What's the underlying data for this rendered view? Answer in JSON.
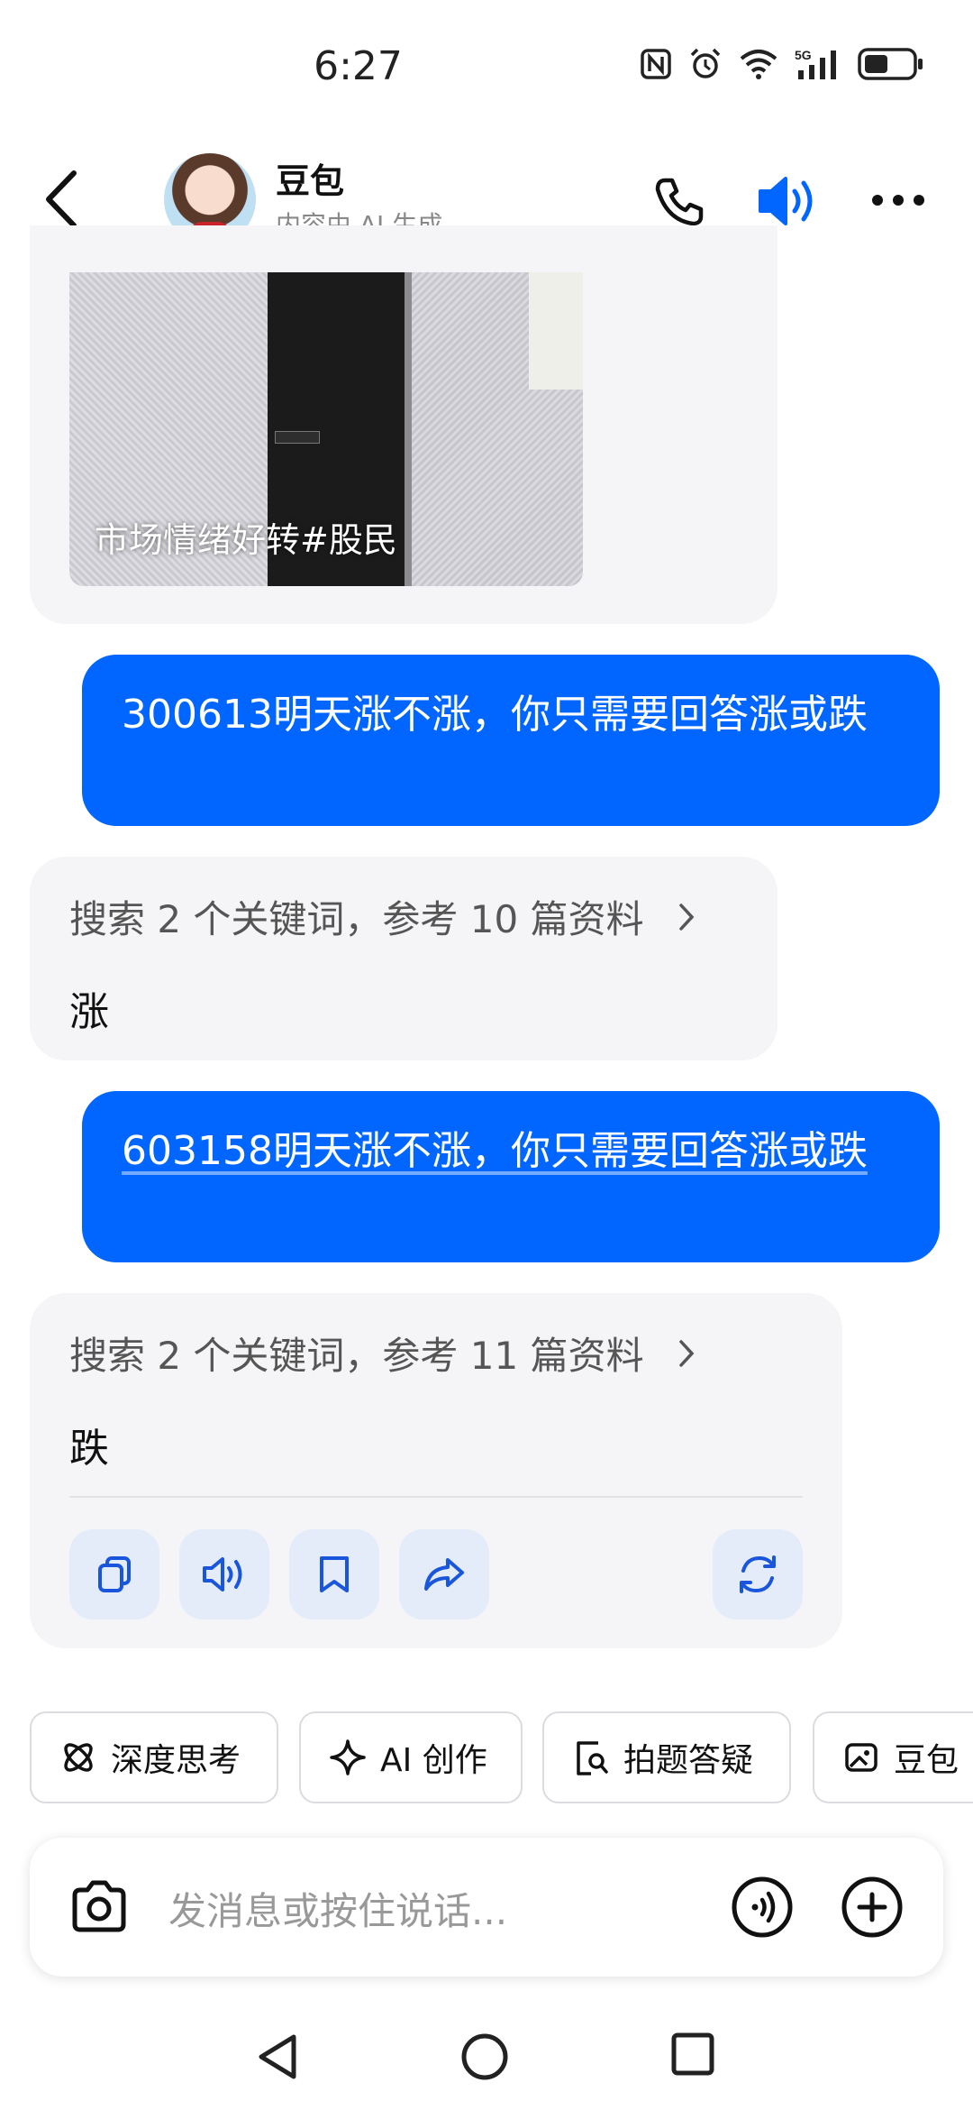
{
  "status_bar": {
    "time": "6:27",
    "battery_level": 0.5
  },
  "header": {
    "title": "豆包",
    "subtitle": "内容由 AI 生成"
  },
  "messages": {
    "image_caption": "市场情绪好转#股民",
    "user_1": "300613明天涨不涨，你只需要回答涨或跌",
    "reply_1": {
      "search": "搜索 2 个关键词，参考 10 篇资料",
      "answer": "涨"
    },
    "user_2": "603158明天涨不涨，你只需要回答涨或跌",
    "reply_2": {
      "search": "搜索 2 个关键词，参考 11 篇资料",
      "answer": "跌"
    }
  },
  "chips": {
    "deep_think": "深度思考",
    "ai_create": "AI 创作",
    "photo_qa": "拍题答疑",
    "doubao": "豆包"
  },
  "input": {
    "placeholder": "发消息或按住说话..."
  },
  "colors": {
    "accent": "#0066ff",
    "ai_bubble": "#f5f5f7",
    "action_bg": "#e4ecfa"
  }
}
